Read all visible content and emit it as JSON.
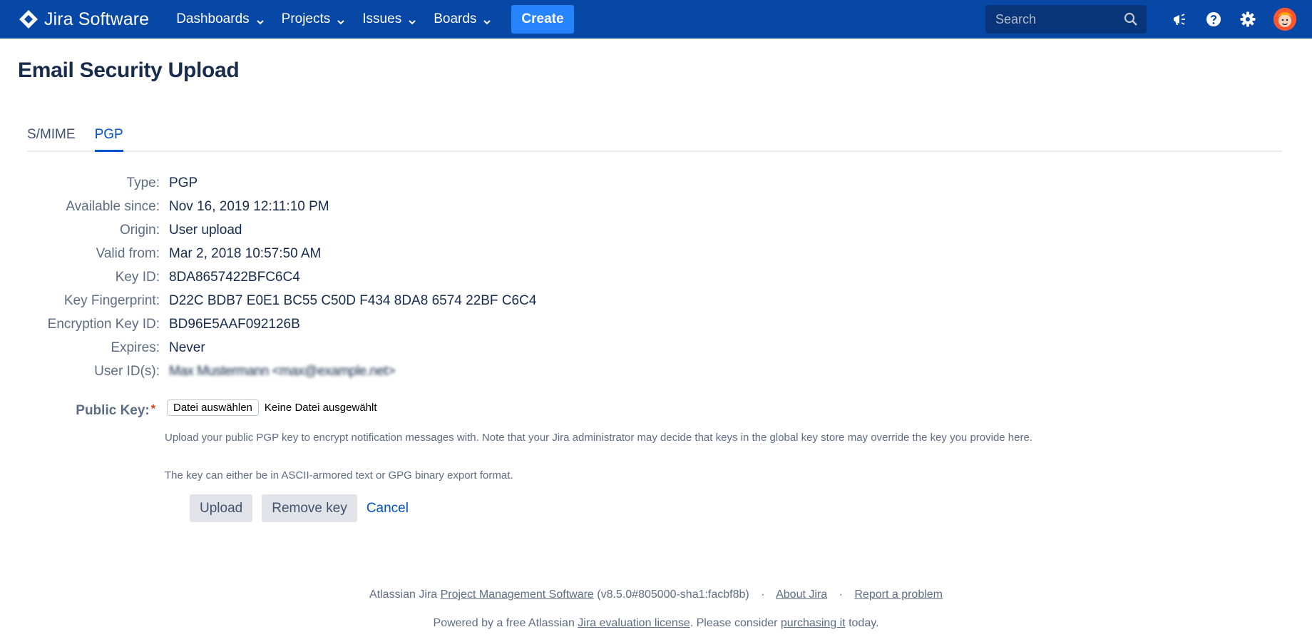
{
  "topbar": {
    "brand": "Jira Software",
    "nav": [
      {
        "label": "Dashboards"
      },
      {
        "label": "Projects"
      },
      {
        "label": "Issues"
      },
      {
        "label": "Boards"
      }
    ],
    "create_label": "Create",
    "search_placeholder": "Search",
    "colors": {
      "bar": "#0747a6",
      "create": "#2684ff"
    }
  },
  "page": {
    "title": "Email Security Upload",
    "tabs": [
      {
        "label": "S/MIME",
        "active": false
      },
      {
        "label": "PGP",
        "active": true
      }
    ]
  },
  "details": [
    {
      "label": "Type:",
      "value": "PGP"
    },
    {
      "label": "Available since:",
      "value": "Nov 16, 2019 12:11:10 PM"
    },
    {
      "label": "Origin:",
      "value": "User upload"
    },
    {
      "label": "Valid from:",
      "value": "Mar 2, 2018 10:57:50 AM"
    },
    {
      "label": "Key ID:",
      "value": "8DA8657422BFC6C4"
    },
    {
      "label": "Key Fingerprint:",
      "value": "D22C BDB7 E0E1 BC55 C50D F434 8DA8 6574 22BF C6C4"
    },
    {
      "label": "Encryption Key ID:",
      "value": "BD96E5AAF092126B"
    },
    {
      "label": "Expires:",
      "value": "Never"
    },
    {
      "label": "User ID(s):",
      "value": "Max Mustermann <max@example.net>"
    }
  ],
  "form": {
    "public_key_label": "Public Key:",
    "required_mark": "*",
    "file_button": "Datei auswählen",
    "file_status": "Keine Datei ausgewählt",
    "help_1": "Upload your public PGP key to encrypt notification messages with. Note that your Jira administrator may decide that keys in the global key store may override the key you provide here.",
    "help_2": "The key can either be in ASCII-armored text or GPG binary export format.",
    "upload_label": "Upload",
    "remove_label": "Remove key",
    "cancel_label": "Cancel"
  },
  "footer": {
    "line1_prefix": "Atlassian Jira ",
    "line1_link": "Project Management Software",
    "line1_version": " (v8.5.0#805000-sha1:facbf8b)",
    "sep": "·",
    "about": "About Jira",
    "report": "Report a problem",
    "line2_prefix": "Powered by a free Atlassian ",
    "line2_link": "Jira evaluation license",
    "line2_mid": ". Please consider ",
    "line2_link2": "purchasing it",
    "line2_suffix": " today."
  }
}
